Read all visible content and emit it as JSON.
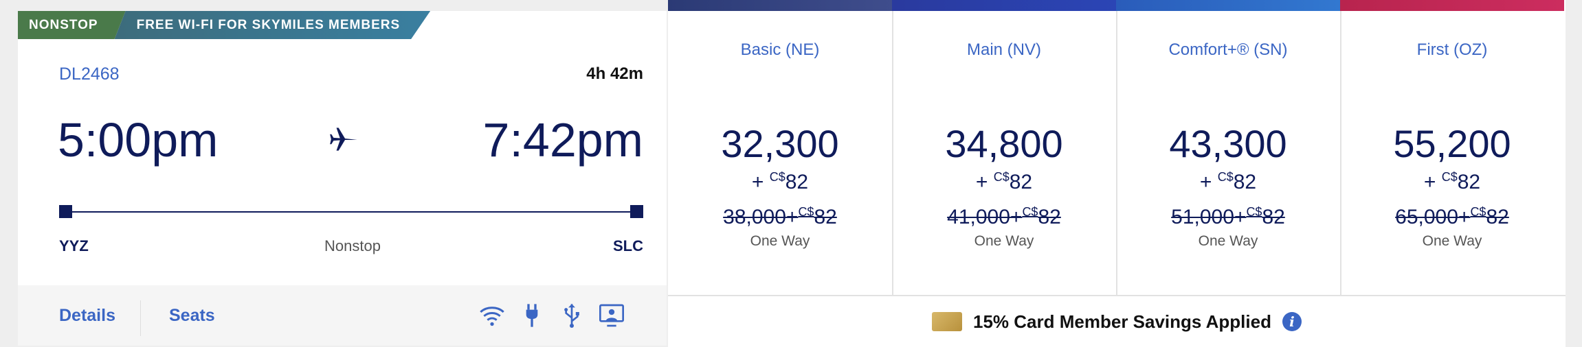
{
  "flight": {
    "badges": {
      "nonstop": "NONSTOP",
      "wifi": "FREE WI-FI FOR SKYMILES MEMBERS"
    },
    "number": "DL2468",
    "duration": "4h 42m",
    "depart_time": "5:00pm",
    "arrive_time": "7:42pm",
    "origin": "YYZ",
    "destination": "SLC",
    "stop_type": "Nonstop",
    "links": {
      "details": "Details",
      "seats": "Seats"
    },
    "amenities": [
      "wifi-icon",
      "power-plug-icon",
      "usb-icon",
      "entertainment-screen-icon"
    ]
  },
  "fares": [
    {
      "name": "Basic (NE)",
      "miles": "32,300",
      "plus": "+ ",
      "currency": "C$",
      "cash": "82",
      "orig_miles": "38,000+",
      "orig_currency": "C$",
      "orig_cash": "82",
      "way": "One Way",
      "color": "#2b3a75"
    },
    {
      "name": "Main (NV)",
      "miles": "34,800",
      "plus": "+ ",
      "currency": "C$",
      "cash": "82",
      "orig_miles": "41,000+",
      "orig_currency": "C$",
      "orig_cash": "82",
      "way": "One Way",
      "color": "#2a3fa8"
    },
    {
      "name": "Comfort+® (SN)",
      "miles": "43,300",
      "plus": "+ ",
      "currency": "C$",
      "cash": "82",
      "orig_miles": "51,000+",
      "orig_currency": "C$",
      "orig_cash": "82",
      "way": "One Way",
      "color": "#2f6ec5"
    },
    {
      "name": "First (OZ)",
      "miles": "55,200",
      "plus": "+ ",
      "currency": "C$",
      "cash": "82",
      "orig_miles": "65,000+",
      "orig_currency": "C$",
      "orig_cash": "82",
      "way": "One Way",
      "color": "#c4285a"
    }
  ],
  "savings": {
    "text": "15% Card Member Savings Applied",
    "info": "i"
  }
}
